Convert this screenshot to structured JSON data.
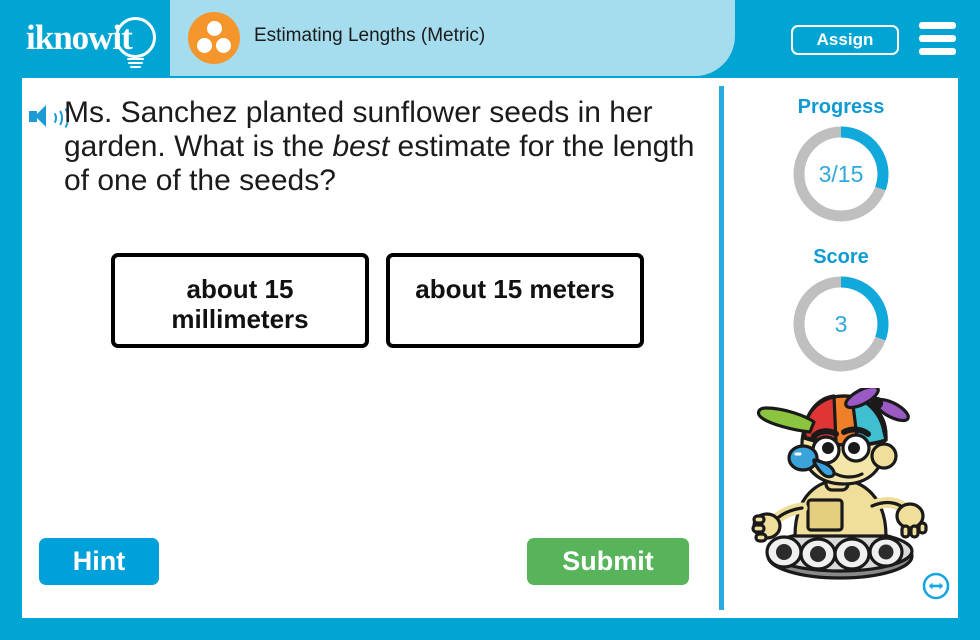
{
  "brand": {
    "logo_text": "iknowit",
    "logo_icon": "lightbulb-icon"
  },
  "header": {
    "lesson_title": "Estimating Lengths (Metric)",
    "lesson_icon": "three-dots-circle-icon",
    "assign_label": "Assign",
    "menu_icon": "hamburger-menu-icon",
    "background_color": "#00A5D4",
    "tab_color": "#A5DCEE",
    "lesson_icon_color": "#F4962C"
  },
  "question": {
    "audio_icon": "speaker-icon",
    "text_part1": "Ms. Sanchez planted sunflower seeds in her garden. What is the ",
    "emphasis": "best",
    "text_part2": " estimate for the length of one of the seeds?"
  },
  "answers": [
    {
      "label": "about 15 millimeters"
    },
    {
      "label": "about 15 meters"
    }
  ],
  "actions": {
    "hint_label": "Hint",
    "submit_label": "Submit",
    "hint_color": "#00A0DA",
    "submit_color": "#58B45B"
  },
  "sidebar": {
    "progress_label": "Progress",
    "progress_value": "3/15",
    "progress_completed": 3,
    "progress_total": 15,
    "score_label": "Score",
    "score_value": "3",
    "ring_track_color": "#BFBFBF",
    "ring_fill_color": "#11A8DB",
    "label_color": "#0E9BD4",
    "mascot_icon": "robot-mascot-propeller-hat",
    "resize_icon": "resize-horizontal-icon"
  }
}
